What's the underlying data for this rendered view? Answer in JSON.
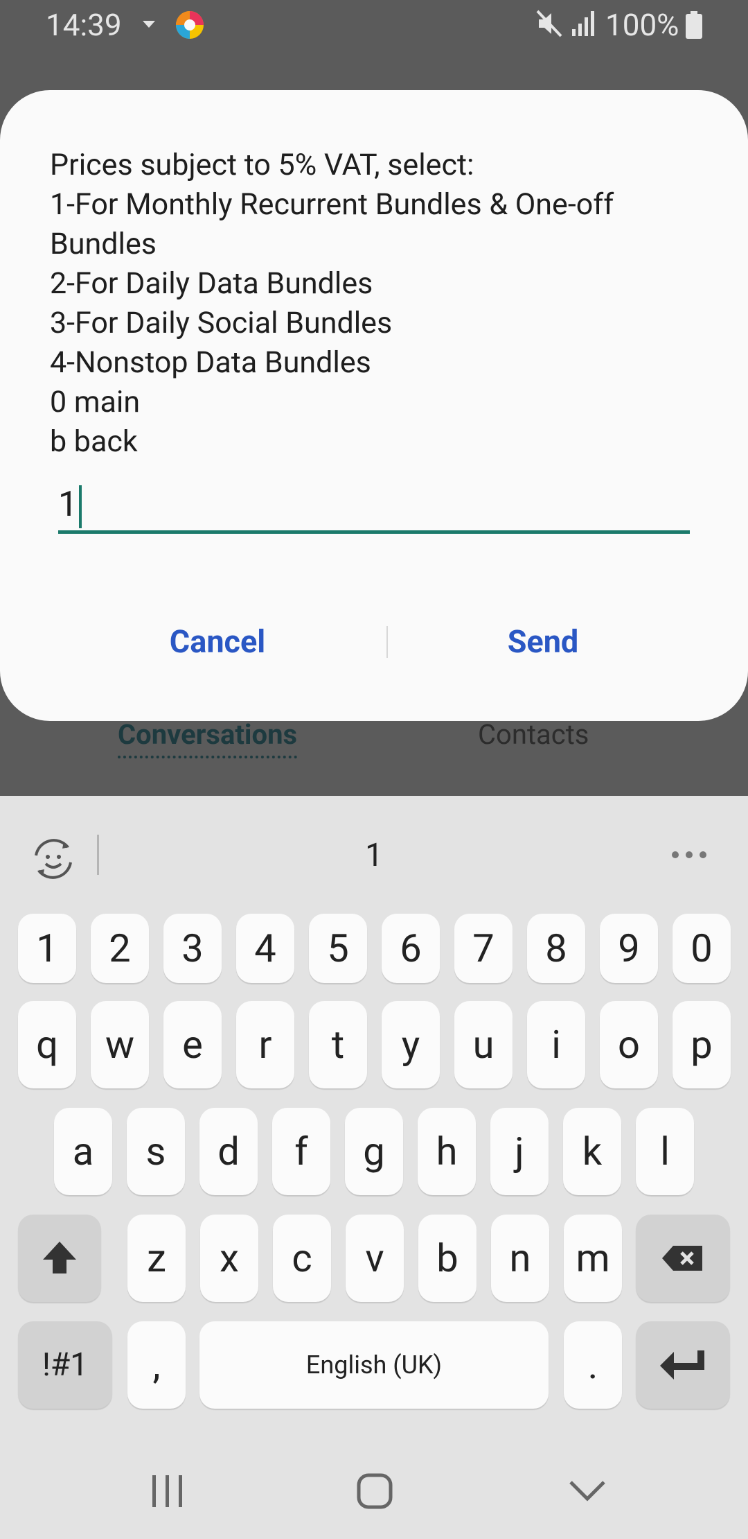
{
  "status_bar": {
    "time": "14:39",
    "battery": "100%"
  },
  "background_app": {
    "tabs": [
      "Conversations",
      "Contacts"
    ]
  },
  "dialog": {
    "message_lines": [
      "Prices subject to 5% VAT, select:",
      "1-For Monthly Recurrent Bundles & One-off",
      "Bundles",
      "2-For Daily Data Bundles",
      "3-For Daily Social Bundles",
      "4-Nonstop Data Bundles",
      "0 main",
      "b back"
    ],
    "input_value": "1",
    "cancel_label": "Cancel",
    "send_label": "Send",
    "accent_color": "#1b7a6b",
    "button_color": "#2a57c4"
  },
  "keyboard": {
    "suggestion": "1",
    "rows": {
      "numbers": [
        "1",
        "2",
        "3",
        "4",
        "5",
        "6",
        "7",
        "8",
        "9",
        "0"
      ],
      "row1": [
        "q",
        "w",
        "e",
        "r",
        "t",
        "y",
        "u",
        "i",
        "o",
        "p"
      ],
      "row2": [
        "a",
        "s",
        "d",
        "f",
        "g",
        "h",
        "j",
        "k",
        "l"
      ],
      "row3": [
        "z",
        "x",
        "c",
        "v",
        "b",
        "n",
        "m"
      ]
    },
    "symbols_label": "!#1",
    "comma_label": ",",
    "space_label": "English (UK)",
    "period_label": ".",
    "icons": {
      "emoji": "emoji-icon",
      "more": "more-options-icon",
      "shift": "shift-icon",
      "backspace": "backspace-icon",
      "enter": "enter-icon"
    }
  },
  "navbar": {
    "icons": [
      "recents-icon",
      "home-icon",
      "back-icon"
    ]
  }
}
